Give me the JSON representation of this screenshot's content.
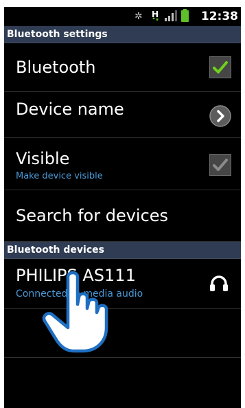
{
  "status_bar": {
    "clock": "12:38",
    "bluetooth_glyph": "✲",
    "data_indicator": "H",
    "icons": [
      "bluetooth-icon",
      "data-h-icon",
      "signal-icon",
      "battery-icon"
    ],
    "battery_color": "#5fbf2a"
  },
  "bluetooth_settings": {
    "header": "Bluetooth settings",
    "bluetooth": {
      "label": "Bluetooth",
      "checked": true
    },
    "device_name": {
      "label": "Device name"
    },
    "visible": {
      "label": "Visible",
      "sublabel": "Make device visible",
      "checked": true,
      "enabled": false
    },
    "search": {
      "label": "Search for devices"
    }
  },
  "bluetooth_devices": {
    "header": "Bluetooth devices",
    "items": [
      {
        "name": "PHILIPS AS111",
        "status": "Connected to media audio",
        "icon": "headphones-icon"
      }
    ]
  },
  "colors": {
    "header_bg": "#2f3c53",
    "accent_blue": "#4a99d6",
    "check_green": "#6fd21c"
  }
}
